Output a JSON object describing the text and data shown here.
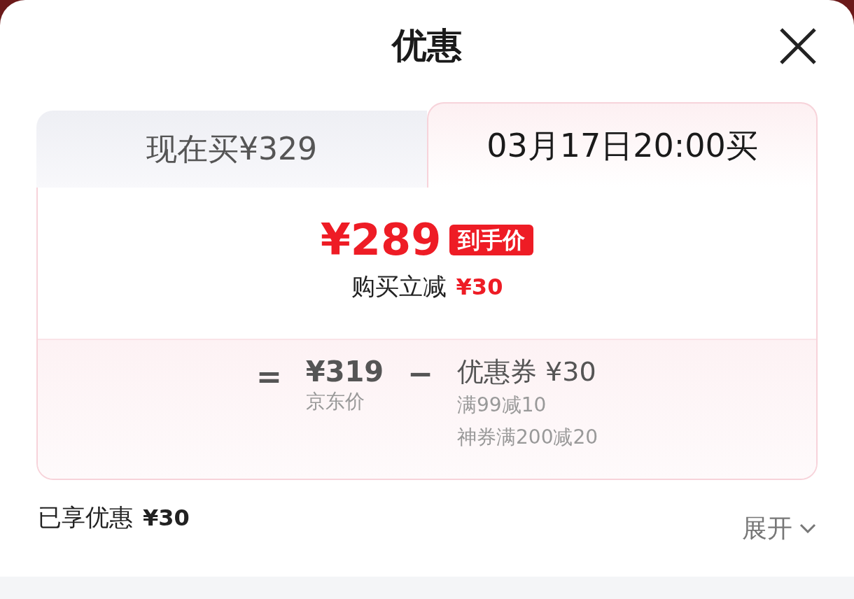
{
  "header": {
    "title": "优惠"
  },
  "tabs": [
    {
      "label": "现在买¥329",
      "selected": false
    },
    {
      "label": "03月17日20:00买",
      "selected": true
    }
  ],
  "price": {
    "value": "¥289",
    "badge": "到手价"
  },
  "reduction": {
    "label": "购买立减",
    "amount": "¥30"
  },
  "formula": {
    "equals": "=",
    "base": {
      "amount": "¥319",
      "label": "京东价"
    },
    "minus": "−",
    "coupon": {
      "title": "优惠券 ¥30",
      "items": [
        "满99减10",
        "神券满200减20"
      ]
    }
  },
  "summary": {
    "label": "已享优惠",
    "amount": "¥30"
  },
  "expand": {
    "label": "展开"
  }
}
